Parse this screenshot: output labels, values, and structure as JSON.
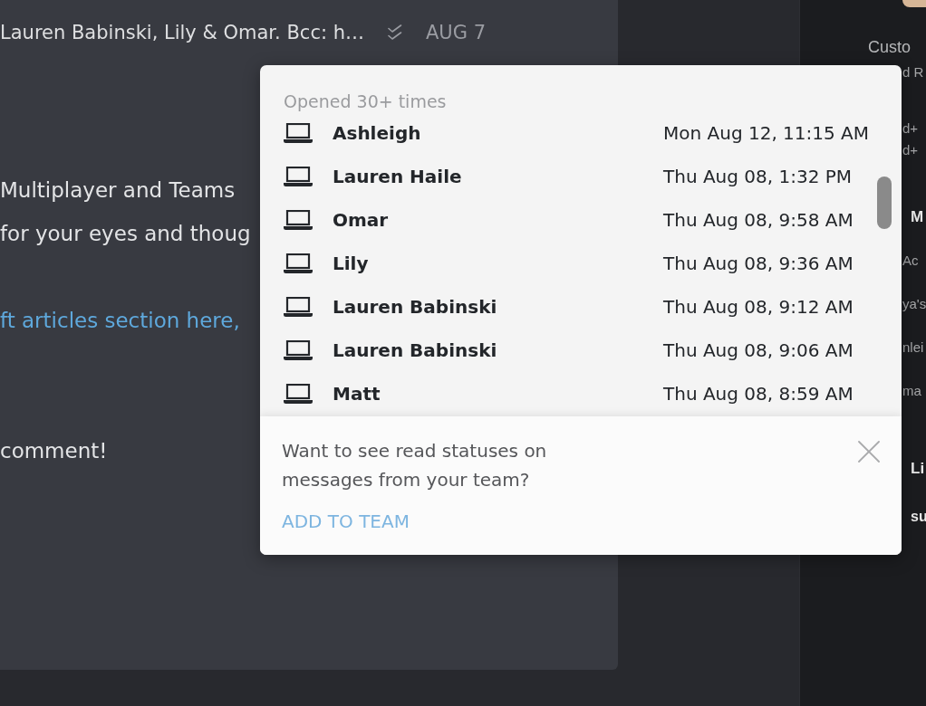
{
  "message": {
    "recipients": "Lauren Babinski, Lily & Omar. Bcc: h…",
    "date": "AUG 7",
    "paragraphs": [
      {
        "kind": "text",
        "lines": [
          "Multiplayer and Teams",
          "for your eyes and thoug"
        ]
      },
      {
        "kind": "link",
        "lines": [
          "ft articles section here,"
        ]
      },
      {
        "kind": "text",
        "lines": [
          "comment!"
        ]
      }
    ]
  },
  "read_receipts": {
    "heading": "Opened 30+ times",
    "opens": [
      {
        "name": "Ashleigh",
        "time": "Mon Aug 12, 11:15 AM"
      },
      {
        "name": "Lauren Haile",
        "time": "Thu Aug 08, 1:32 PM"
      },
      {
        "name": "Omar",
        "time": "Thu Aug 08, 9:58 AM"
      },
      {
        "name": "Lily",
        "time": "Thu Aug 08, 9:36 AM"
      },
      {
        "name": "Lauren Babinski",
        "time": "Thu Aug 08, 9:12 AM"
      },
      {
        "name": "Lauren Babinski",
        "time": "Thu Aug 08, 9:06 AM"
      },
      {
        "name": "Matt",
        "time": "Thu Aug 08, 8:59 AM"
      }
    ],
    "promo": {
      "text": "Want to see read statuses on messages from your team?",
      "action": "ADD TO TEAM"
    }
  },
  "sidebar": {
    "sections": [
      {
        "lines": [
          {
            "kind": "caption",
            "text": "Custo"
          },
          {
            "kind": "detail",
            "text": "d R"
          }
        ]
      },
      {
        "lines": [
          {
            "kind": "detail",
            "text": "d+"
          },
          {
            "kind": "detail",
            "text": "d+"
          }
        ]
      },
      {
        "lines": [
          {
            "kind": "heading",
            "text": "M"
          },
          {
            "kind": "item",
            "text": "Ac"
          },
          {
            "kind": "item",
            "text": "ya's"
          },
          {
            "kind": "item",
            "text": "nlei"
          },
          {
            "kind": "item",
            "text": "ma"
          }
        ]
      },
      {
        "lines": [
          {
            "kind": "heading",
            "text": "Li"
          },
          {
            "kind": "strong",
            "text": "su"
          }
        ]
      }
    ]
  }
}
